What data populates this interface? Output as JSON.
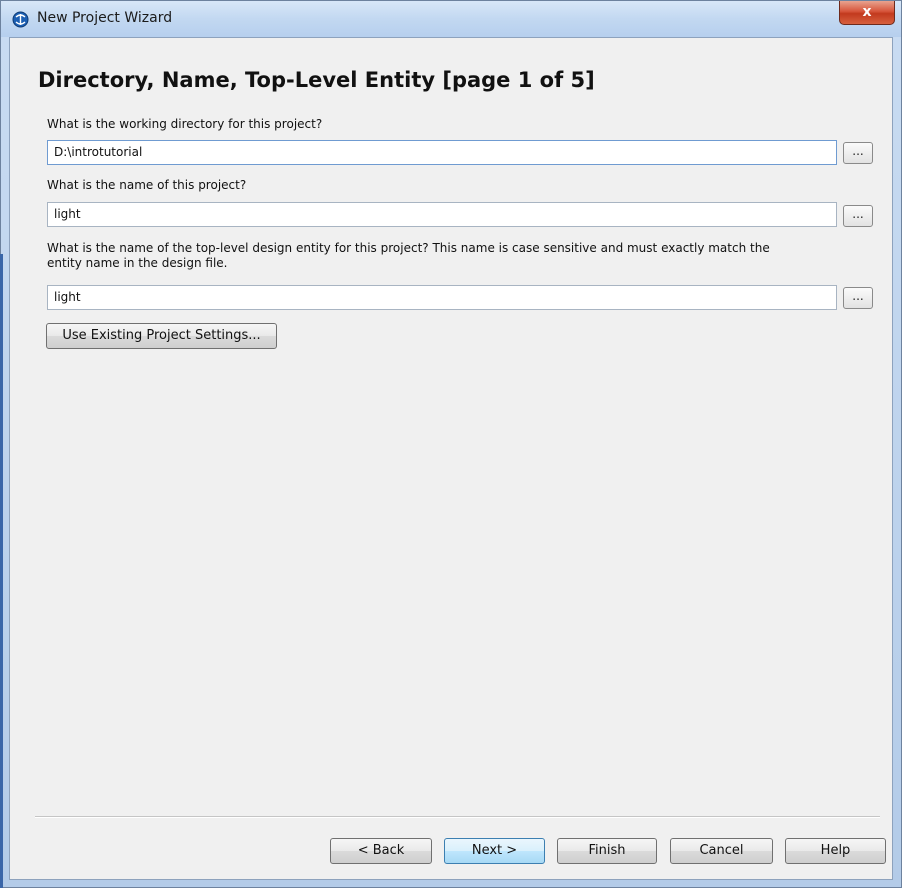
{
  "window": {
    "title": "New Project Wizard",
    "close_label": "x",
    "accent_color": "#3a66a8",
    "close_color": "#c23a1e"
  },
  "page": {
    "heading": "Directory, Name, Top-Level Entity [page 1 of 5]"
  },
  "fields": {
    "directory": {
      "label": "What is the working directory for this project?",
      "value": "D:\\introtutorial"
    },
    "project_name": {
      "label": "What is the name of this project?",
      "value": "light"
    },
    "top_level": {
      "label_line1": "What is the name of the top-level design entity for this project? This name is case sensitive and must exactly match the",
      "label_line2": "entity name in the design file.",
      "value": "light"
    },
    "browse_label": "..."
  },
  "buttons": {
    "use_existing": "Use Existing Project Settings...",
    "back": "< Back",
    "next": "Next >",
    "finish": "Finish",
    "cancel": "Cancel",
    "help": "Help"
  }
}
